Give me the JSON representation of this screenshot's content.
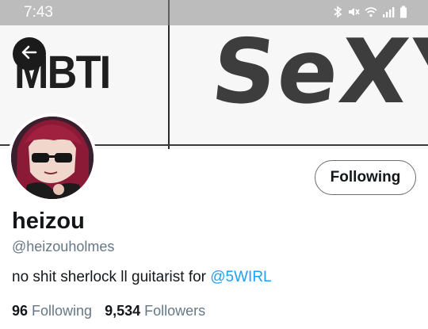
{
  "status_bar": {
    "time": "7:43",
    "icons": [
      "bluetooth-icon",
      "mute-icon",
      "wifi-icon",
      "signal-icon",
      "battery-icon"
    ]
  },
  "banner": {
    "left_text": "MBTI",
    "right_text": "SeXY"
  },
  "profile": {
    "display_name": "heizou",
    "handle": "@heizouholmes",
    "bio_text": "no shit sherlock ll guitarist for ",
    "bio_link": "@5WIRL",
    "following_count": "96",
    "following_label": "Following",
    "followers_count": "9,534",
    "followers_label": "Followers"
  },
  "actions": {
    "follow_button_label": "Following"
  },
  "colors": {
    "link": "#1da1f2",
    "secondary_text": "#657786",
    "primary_text": "#14171a"
  }
}
